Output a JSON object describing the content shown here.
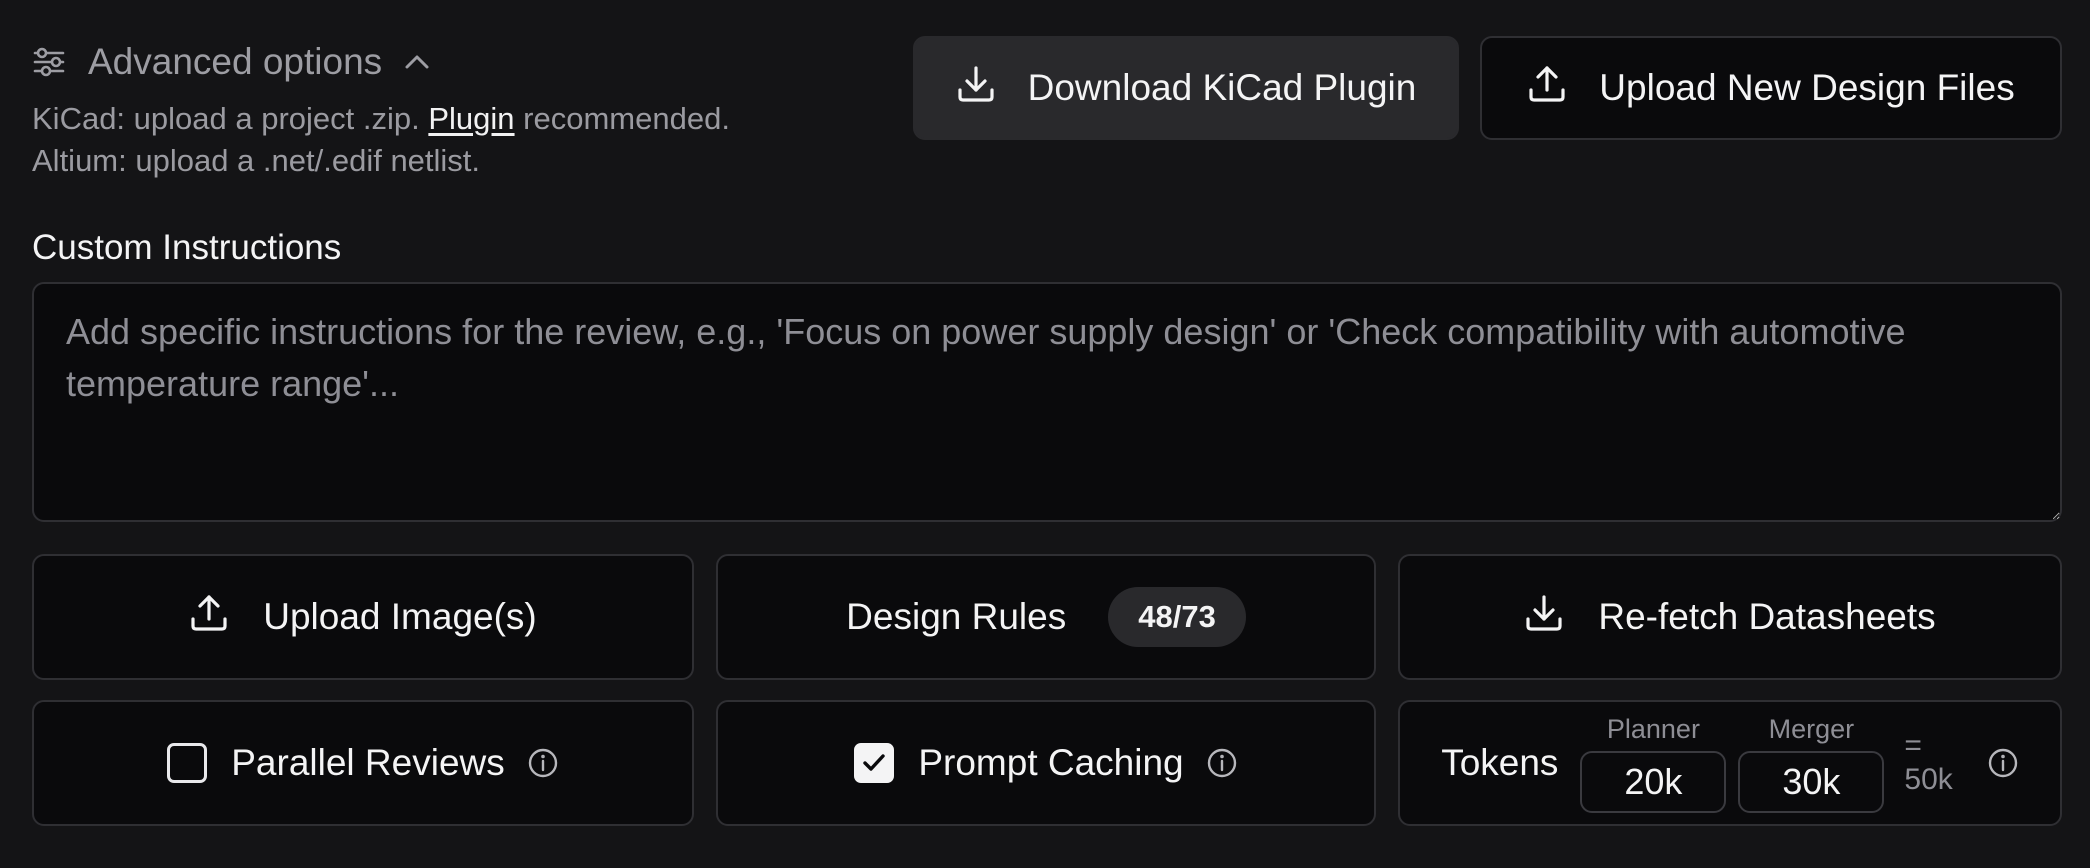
{
  "advanced": {
    "toggle_label": "Advanced options",
    "hint_kicad_prefix": "KiCad: upload a project .zip.",
    "hint_kicad_link": "Plugin",
    "hint_kicad_suffix": "recommended.",
    "hint_altium": "Altium: upload a .net/.edif netlist."
  },
  "actions": {
    "download_plugin_label": "Download KiCad Plugin",
    "upload_design_label": "Upload New Design Files"
  },
  "instructions": {
    "label": "Custom Instructions",
    "placeholder": "Add specific instructions for the review, e.g., 'Focus on power supply design' or 'Check compatibility with automotive temperature range'...",
    "value": ""
  },
  "tools": {
    "upload_images_label": "Upload Image(s)",
    "design_rules_label": "Design Rules",
    "design_rules_count": "48/73",
    "refetch_label": "Re-fetch Datasheets"
  },
  "options": {
    "parallel_reviews_label": "Parallel Reviews",
    "parallel_reviews_checked": false,
    "prompt_caching_label": "Prompt Caching",
    "prompt_caching_checked": true
  },
  "tokens": {
    "label": "Tokens",
    "planner_label": "Planner",
    "planner_value": "20k",
    "merger_label": "Merger",
    "merger_value": "30k",
    "equals": "=",
    "total": "50k"
  },
  "colors": {
    "background": "#141416",
    "surface": "#0a0a0c",
    "secondary": "#29292c",
    "border": "#2f2f33",
    "text": "#f4f4f5",
    "muted": "#8e8e95"
  }
}
